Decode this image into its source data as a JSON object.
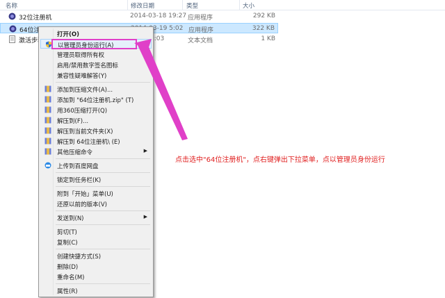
{
  "header": {
    "col_name": "名称",
    "col_date": "修改日期",
    "col_type": "类型",
    "col_size": "大小"
  },
  "files": [
    {
      "name": "32位注册机",
      "date": "2014-03-18 19:27",
      "type": "应用程序",
      "size": "292 KB"
    },
    {
      "name": "64位注册机",
      "date": "2014-03-19 5:02",
      "type": "应用程序",
      "size": "322 KB"
    },
    {
      "name": "激活步骤",
      "date": "…02 11:03",
      "type": "文本文档",
      "size": "1 KB"
    }
  ],
  "menu": {
    "open": "打开(O)",
    "run_as_admin": "以管理员身份运行(A)",
    "take_ownership": "管理员取得所有权",
    "toggle_signature": "启用/禁用数字签名图标",
    "compat": "兼容性疑难解答(Y)",
    "add_archive": "添加到压缩文件(A)...",
    "add_zip": "添加到 \"64位注册机.zip\" (T)",
    "open_360": "用360压缩打开(Q)",
    "extract_to": "解压到(F)...",
    "extract_here": "解压到当前文件夹(X)",
    "extract_folder": "解压到 64位注册机\\ (E)",
    "other_cmds": "其他压缩命令",
    "upload_baidu": "上传到百度网盘",
    "pin_taskbar": "锁定到任务栏(K)",
    "pin_start": "附到「开始」菜单(U)",
    "restore_prev": "还原以前的版本(V)",
    "send_to": "发送到(N)",
    "cut": "剪切(T)",
    "copy": "复制(C)",
    "create_shortcut": "创建快捷方式(S)",
    "delete": "删除(D)",
    "rename": "重命名(M)",
    "properties": "属性(R)"
  },
  "annotation": "点击选中\"64位注册机\"，点右键弹出下拉菜单，点以管理员身份运行",
  "colors": {
    "highlight_box": "#e040c8",
    "annotation_text": "#e02020"
  }
}
